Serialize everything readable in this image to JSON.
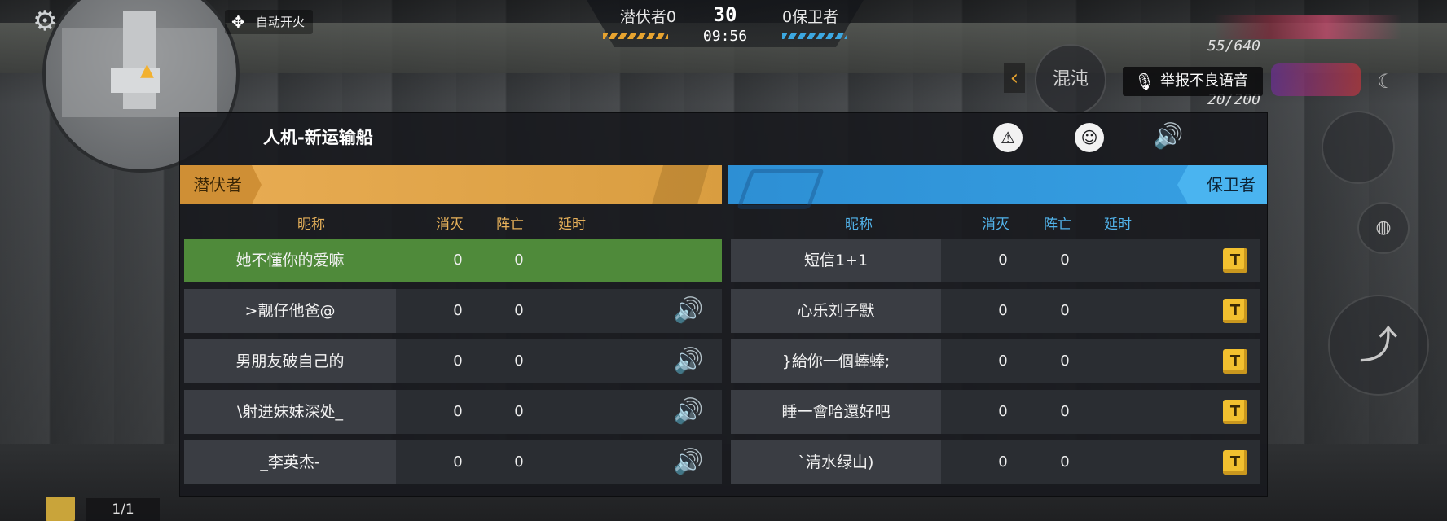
{
  "hud": {
    "team_left": "潜伏者",
    "team_left_score": "0",
    "team_right": "保卫者",
    "team_right_score": "0",
    "target_score": "30",
    "timer": "09:56",
    "auto_fire": "自动开火",
    "mode": "混沌",
    "report_voice": "举报不良语音",
    "ammo_primary": "55/640",
    "ammo_secondary": "20/200",
    "item_count": "1/1"
  },
  "panel": {
    "title": "人机-新运输船"
  },
  "teams": {
    "left": {
      "name": "潜伏者",
      "columns": {
        "nickname": "昵称",
        "kills": "消灭",
        "deaths": "阵亡",
        "ping": "延时"
      },
      "players": [
        {
          "name": "她不懂你的爱嘛",
          "kills": "0",
          "deaths": "0",
          "self": true
        },
        {
          "name": ">靓仔他爸@",
          "kills": "0",
          "deaths": "0"
        },
        {
          "name": "男朋友破自己的",
          "kills": "0",
          "deaths": "0"
        },
        {
          "name": "\\射进妹妹深处_",
          "kills": "0",
          "deaths": "0"
        },
        {
          "name": "_李英杰-",
          "kills": "0",
          "deaths": "0"
        }
      ]
    },
    "right": {
      "name": "保卫者",
      "columns": {
        "nickname": "昵称",
        "kills": "消灭",
        "deaths": "阵亡",
        "ping": "延时"
      },
      "players": [
        {
          "name": "短信1+1",
          "kills": "0",
          "deaths": "0"
        },
        {
          "name": "心乐刘子默",
          "kills": "0",
          "deaths": "0"
        },
        {
          "name": "}給你一個蜯蜯;",
          "kills": "0",
          "deaths": "0"
        },
        {
          "name": "睡一會哈還好吧",
          "kills": "0",
          "deaths": "0"
        },
        {
          "name": "`清水绿山)",
          "kills": "0",
          "deaths": "0"
        }
      ]
    }
  },
  "icons": {
    "settings": "gear-icon",
    "speaker": "speaker-icon",
    "badge": "t-badge-icon",
    "mic": "mic-icon"
  },
  "colors": {
    "left_team": "#e9ad54",
    "right_team": "#37a0e3",
    "self_row": "#4f8a3a",
    "speaker": "#f2b130"
  }
}
